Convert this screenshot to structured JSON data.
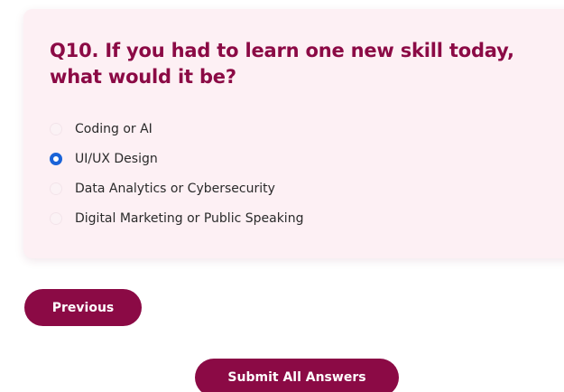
{
  "question": {
    "text": "Q10. If you had to learn one new skill today, what would it be?"
  },
  "options": [
    {
      "label": "Coding or AI",
      "selected": false
    },
    {
      "label": "UI/UX Design",
      "selected": true
    },
    {
      "label": "Data Analytics or Cybersecurity",
      "selected": false
    },
    {
      "label": "Digital Marketing or Public Speaking",
      "selected": false
    }
  ],
  "buttons": {
    "previous_label": "Previous",
    "submit_label": "Submit All Answers"
  },
  "colors": {
    "accent": "#8b0a45",
    "card_background": "#fdf0f4",
    "radio_selected": "#1a63d8"
  }
}
